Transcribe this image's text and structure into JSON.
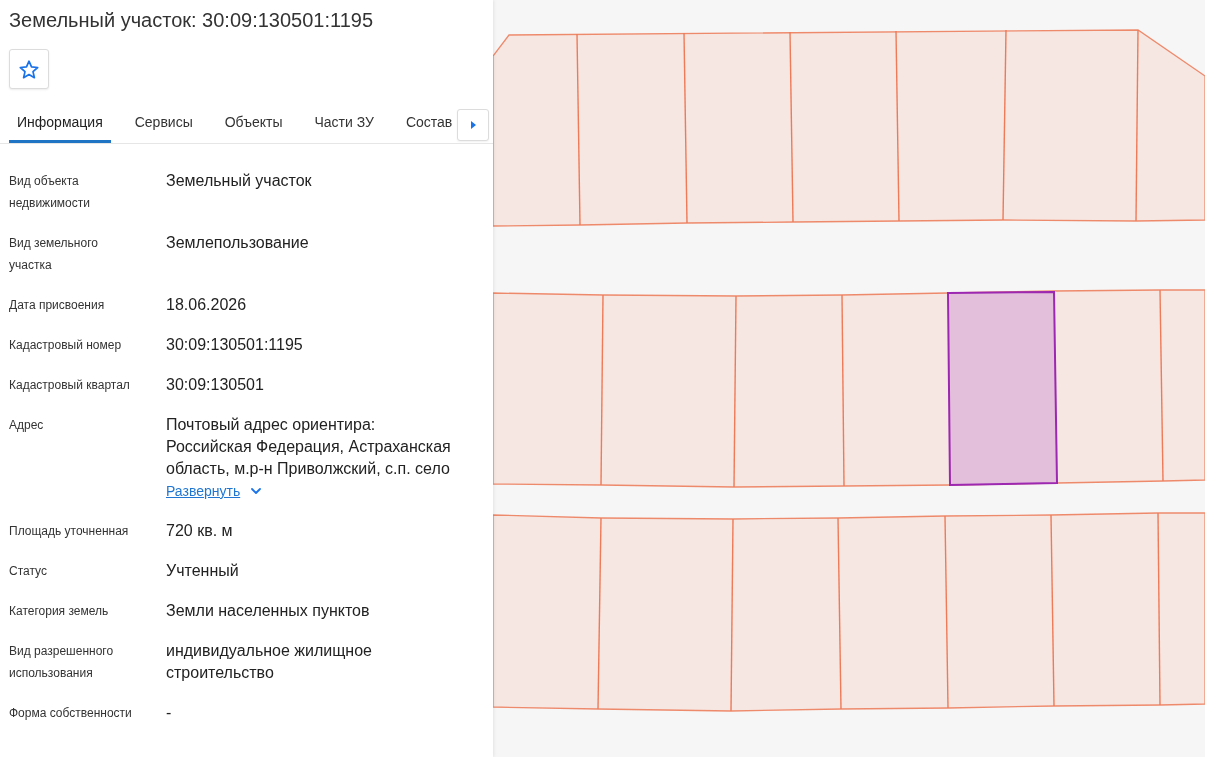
{
  "title": "Земельный участок: 30:09:130501:1195",
  "tabs": [
    {
      "label": "Информация",
      "selected": true
    },
    {
      "label": "Сервисы",
      "selected": false
    },
    {
      "label": "Объекты",
      "selected": false
    },
    {
      "label": "Части ЗУ",
      "selected": false
    },
    {
      "label": "Состав",
      "selected": false
    }
  ],
  "fields": [
    {
      "label": "Вид объекта недвижимости",
      "value": "Земельный участок"
    },
    {
      "label": "Вид земельного участка",
      "value": "Землепользование"
    },
    {
      "label": "Дата присвоения",
      "value": "18.06.2026"
    },
    {
      "label": "Кадастровый номер",
      "value": "30:09:130501:1195"
    },
    {
      "label": "Кадастровый квартал",
      "value": "30:09:130501"
    },
    {
      "label": "Адрес",
      "value": "Почтовый адрес ориентира:\nРоссийская Федерация, Астраханская область, м.р-н Приволжский, с.п. село",
      "expand_link": "Развернуть"
    },
    {
      "label": "Площадь уточненная",
      "value": "720 кв. м"
    },
    {
      "label": "Статус",
      "value": "Учтенный"
    },
    {
      "label": "Категория земель",
      "value": "Земли населенных пунктов"
    },
    {
      "label": "Вид разрешенного использования",
      "value": "индивидуальное жилищное строительство"
    },
    {
      "label": "Форма собственности",
      "value": "-"
    }
  ]
}
